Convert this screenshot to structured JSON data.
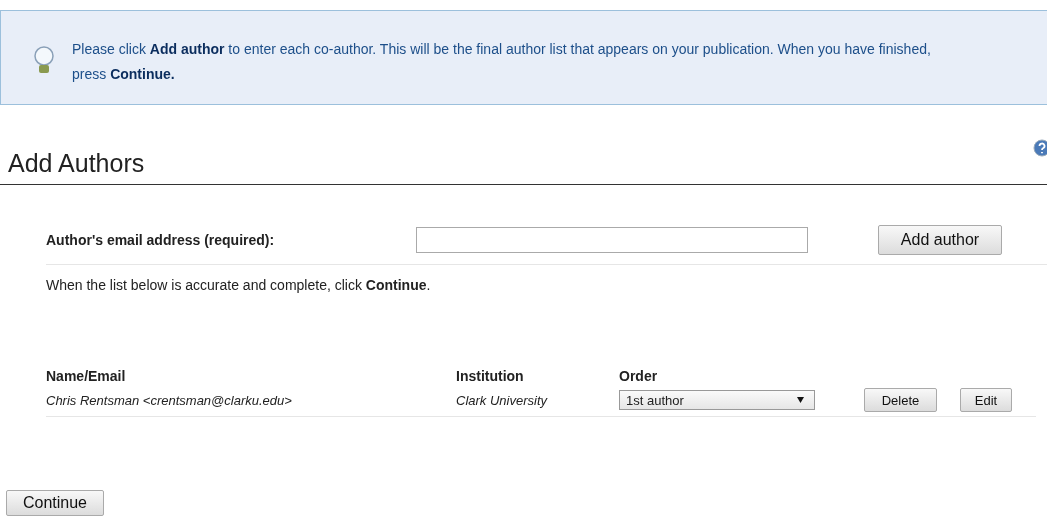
{
  "notice": {
    "text": "Please click **Add author** to enter each co-author. This will be the final author list that appears on your publication. When you have finished, press **Continue.**"
  },
  "heading": "Add Authors",
  "email_field": {
    "label": "Author's email address (required):",
    "button": "Add author"
  },
  "instruction": "When the list below is accurate and complete, click **Continue**.",
  "table": {
    "columns": [
      "Name/Email",
      "Institution",
      "Order"
    ],
    "rows": [
      {
        "name_email": "Chris Rentsman <crentsman@clarku.edu>",
        "institution": "Clark University",
        "order": "1st author",
        "actions": [
          "Delete",
          "Edit"
        ]
      }
    ]
  },
  "continue_button": "Continue"
}
